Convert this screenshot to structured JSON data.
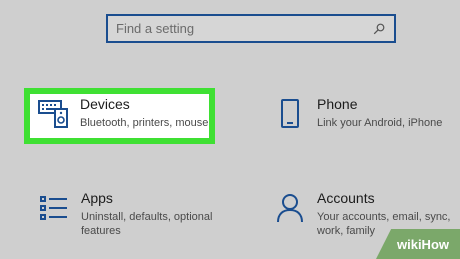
{
  "search": {
    "placeholder": "Find a setting",
    "icon": "search-icon"
  },
  "tiles": [
    {
      "title": "Devices",
      "description": "Bluetooth, printers, mouse",
      "icon": "devices-icon"
    },
    {
      "title": "Phone",
      "description": "Link your Android, iPhone",
      "icon": "phone-icon"
    },
    {
      "title": "Apps",
      "description_lines": [
        "Uninstall, defaults, optional",
        "features"
      ],
      "icon": "apps-icon"
    },
    {
      "title": "Accounts",
      "description_lines": [
        "Your accounts, email, sync,",
        "work, family"
      ],
      "icon": "accounts-icon"
    }
  ],
  "watermark": {
    "text": "wikiHow"
  },
  "colors": {
    "accent": "#1a4d8f",
    "highlight": "#3fe033",
    "background": "#cfcfcf"
  }
}
